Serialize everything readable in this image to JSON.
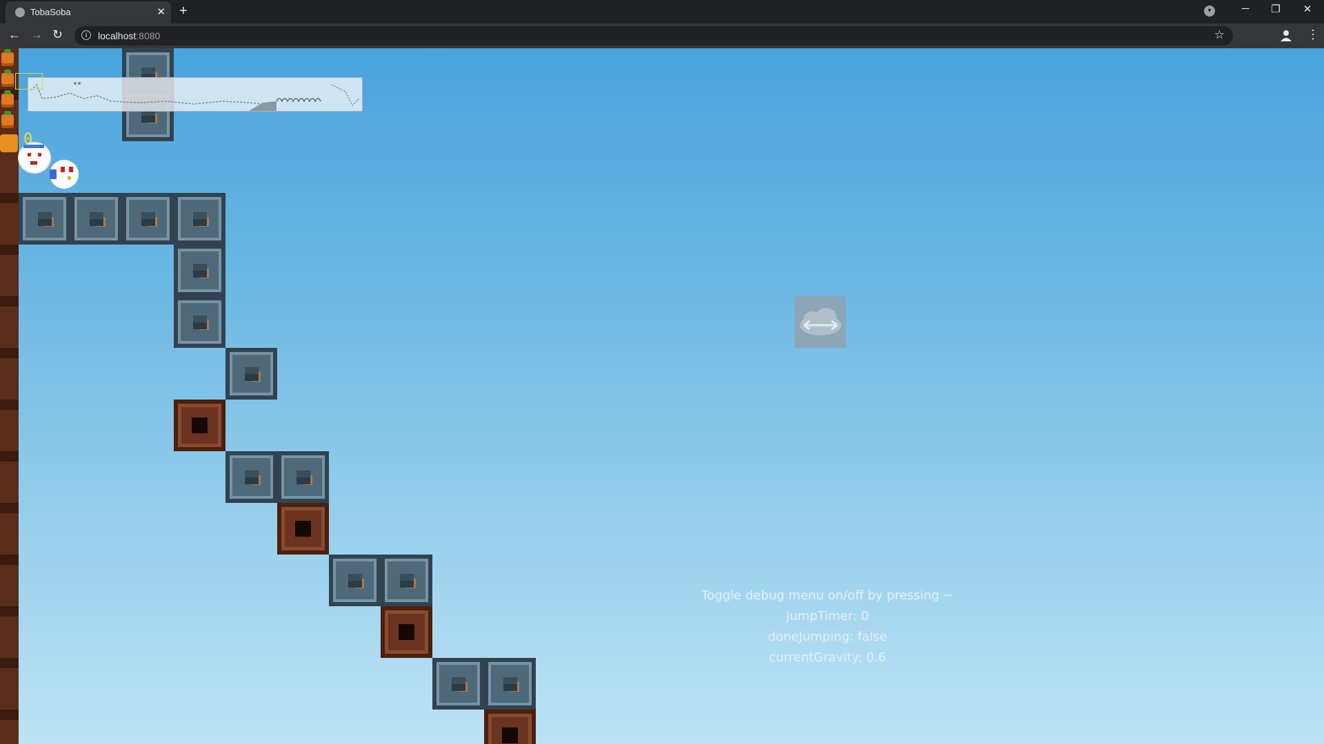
{
  "browser": {
    "tab_title": "TobaSoba",
    "tab_close_glyph": "✕",
    "new_tab_glyph": "+",
    "url_host": "localhost",
    "url_port": ":8080",
    "icons": [
      "favicon-icon",
      "back-arrow-icon",
      "forward-arrow-icon",
      "reload-icon",
      "info-icon",
      "star-icon",
      "profile-icon",
      "menu-icon",
      "tab-search-icon",
      "minimize-icon",
      "restore-icon",
      "close-window-icon"
    ]
  },
  "game": {
    "coin_count": "0",
    "hearts": 4,
    "debug": {
      "line1": "Toggle debug menu on/off by pressing ~",
      "line2": "jumpTimer: 0",
      "line3": "doneJumping: false",
      "line4": "currentGravity: 0.6"
    },
    "colors": {
      "sky_top": "#4aa3dc",
      "sky_bottom": "#bde3f5",
      "stone_tile": "#4e6a7a",
      "dirt_tile": "#6b3420",
      "coin_text": "#f5e03a"
    }
  }
}
